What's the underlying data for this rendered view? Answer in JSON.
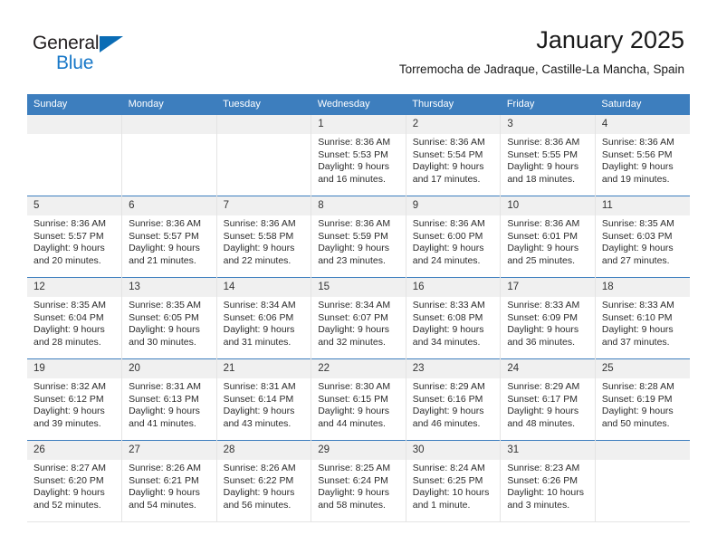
{
  "brand": {
    "name_part1": "General",
    "name_part2": "Blue",
    "triangle_color": "#0a6cb5",
    "blue_text_color": "#1878c8"
  },
  "header": {
    "title": "January 2025",
    "subtitle": "Torremocha de Jadraque, Castille-La Mancha, Spain"
  },
  "theme": {
    "header_blue": "#3d7ebe",
    "daynum_band": "#f0f0f0",
    "cell_border": "#e4e4e4"
  },
  "weekdays": [
    "Sunday",
    "Monday",
    "Tuesday",
    "Wednesday",
    "Thursday",
    "Friday",
    "Saturday"
  ],
  "weeks": [
    [
      {
        "day": "",
        "lines": []
      },
      {
        "day": "",
        "lines": []
      },
      {
        "day": "",
        "lines": []
      },
      {
        "day": "1",
        "lines": [
          "Sunrise: 8:36 AM",
          "Sunset: 5:53 PM",
          "Daylight: 9 hours",
          "and 16 minutes."
        ]
      },
      {
        "day": "2",
        "lines": [
          "Sunrise: 8:36 AM",
          "Sunset: 5:54 PM",
          "Daylight: 9 hours",
          "and 17 minutes."
        ]
      },
      {
        "day": "3",
        "lines": [
          "Sunrise: 8:36 AM",
          "Sunset: 5:55 PM",
          "Daylight: 9 hours",
          "and 18 minutes."
        ]
      },
      {
        "day": "4",
        "lines": [
          "Sunrise: 8:36 AM",
          "Sunset: 5:56 PM",
          "Daylight: 9 hours",
          "and 19 minutes."
        ]
      }
    ],
    [
      {
        "day": "5",
        "lines": [
          "Sunrise: 8:36 AM",
          "Sunset: 5:57 PM",
          "Daylight: 9 hours",
          "and 20 minutes."
        ]
      },
      {
        "day": "6",
        "lines": [
          "Sunrise: 8:36 AM",
          "Sunset: 5:57 PM",
          "Daylight: 9 hours",
          "and 21 minutes."
        ]
      },
      {
        "day": "7",
        "lines": [
          "Sunrise: 8:36 AM",
          "Sunset: 5:58 PM",
          "Daylight: 9 hours",
          "and 22 minutes."
        ]
      },
      {
        "day": "8",
        "lines": [
          "Sunrise: 8:36 AM",
          "Sunset: 5:59 PM",
          "Daylight: 9 hours",
          "and 23 minutes."
        ]
      },
      {
        "day": "9",
        "lines": [
          "Sunrise: 8:36 AM",
          "Sunset: 6:00 PM",
          "Daylight: 9 hours",
          "and 24 minutes."
        ]
      },
      {
        "day": "10",
        "lines": [
          "Sunrise: 8:36 AM",
          "Sunset: 6:01 PM",
          "Daylight: 9 hours",
          "and 25 minutes."
        ]
      },
      {
        "day": "11",
        "lines": [
          "Sunrise: 8:35 AM",
          "Sunset: 6:03 PM",
          "Daylight: 9 hours",
          "and 27 minutes."
        ]
      }
    ],
    [
      {
        "day": "12",
        "lines": [
          "Sunrise: 8:35 AM",
          "Sunset: 6:04 PM",
          "Daylight: 9 hours",
          "and 28 minutes."
        ]
      },
      {
        "day": "13",
        "lines": [
          "Sunrise: 8:35 AM",
          "Sunset: 6:05 PM",
          "Daylight: 9 hours",
          "and 30 minutes."
        ]
      },
      {
        "day": "14",
        "lines": [
          "Sunrise: 8:34 AM",
          "Sunset: 6:06 PM",
          "Daylight: 9 hours",
          "and 31 minutes."
        ]
      },
      {
        "day": "15",
        "lines": [
          "Sunrise: 8:34 AM",
          "Sunset: 6:07 PM",
          "Daylight: 9 hours",
          "and 32 minutes."
        ]
      },
      {
        "day": "16",
        "lines": [
          "Sunrise: 8:33 AM",
          "Sunset: 6:08 PM",
          "Daylight: 9 hours",
          "and 34 minutes."
        ]
      },
      {
        "day": "17",
        "lines": [
          "Sunrise: 8:33 AM",
          "Sunset: 6:09 PM",
          "Daylight: 9 hours",
          "and 36 minutes."
        ]
      },
      {
        "day": "18",
        "lines": [
          "Sunrise: 8:33 AM",
          "Sunset: 6:10 PM",
          "Daylight: 9 hours",
          "and 37 minutes."
        ]
      }
    ],
    [
      {
        "day": "19",
        "lines": [
          "Sunrise: 8:32 AM",
          "Sunset: 6:12 PM",
          "Daylight: 9 hours",
          "and 39 minutes."
        ]
      },
      {
        "day": "20",
        "lines": [
          "Sunrise: 8:31 AM",
          "Sunset: 6:13 PM",
          "Daylight: 9 hours",
          "and 41 minutes."
        ]
      },
      {
        "day": "21",
        "lines": [
          "Sunrise: 8:31 AM",
          "Sunset: 6:14 PM",
          "Daylight: 9 hours",
          "and 43 minutes."
        ]
      },
      {
        "day": "22",
        "lines": [
          "Sunrise: 8:30 AM",
          "Sunset: 6:15 PM",
          "Daylight: 9 hours",
          "and 44 minutes."
        ]
      },
      {
        "day": "23",
        "lines": [
          "Sunrise: 8:29 AM",
          "Sunset: 6:16 PM",
          "Daylight: 9 hours",
          "and 46 minutes."
        ]
      },
      {
        "day": "24",
        "lines": [
          "Sunrise: 8:29 AM",
          "Sunset: 6:17 PM",
          "Daylight: 9 hours",
          "and 48 minutes."
        ]
      },
      {
        "day": "25",
        "lines": [
          "Sunrise: 8:28 AM",
          "Sunset: 6:19 PM",
          "Daylight: 9 hours",
          "and 50 minutes."
        ]
      }
    ],
    [
      {
        "day": "26",
        "lines": [
          "Sunrise: 8:27 AM",
          "Sunset: 6:20 PM",
          "Daylight: 9 hours",
          "and 52 minutes."
        ]
      },
      {
        "day": "27",
        "lines": [
          "Sunrise: 8:26 AM",
          "Sunset: 6:21 PM",
          "Daylight: 9 hours",
          "and 54 minutes."
        ]
      },
      {
        "day": "28",
        "lines": [
          "Sunrise: 8:26 AM",
          "Sunset: 6:22 PM",
          "Daylight: 9 hours",
          "and 56 minutes."
        ]
      },
      {
        "day": "29",
        "lines": [
          "Sunrise: 8:25 AM",
          "Sunset: 6:24 PM",
          "Daylight: 9 hours",
          "and 58 minutes."
        ]
      },
      {
        "day": "30",
        "lines": [
          "Sunrise: 8:24 AM",
          "Sunset: 6:25 PM",
          "Daylight: 10 hours",
          "and 1 minute."
        ]
      },
      {
        "day": "31",
        "lines": [
          "Sunrise: 8:23 AM",
          "Sunset: 6:26 PM",
          "Daylight: 10 hours",
          "and 3 minutes."
        ]
      },
      {
        "day": "",
        "lines": []
      }
    ]
  ]
}
